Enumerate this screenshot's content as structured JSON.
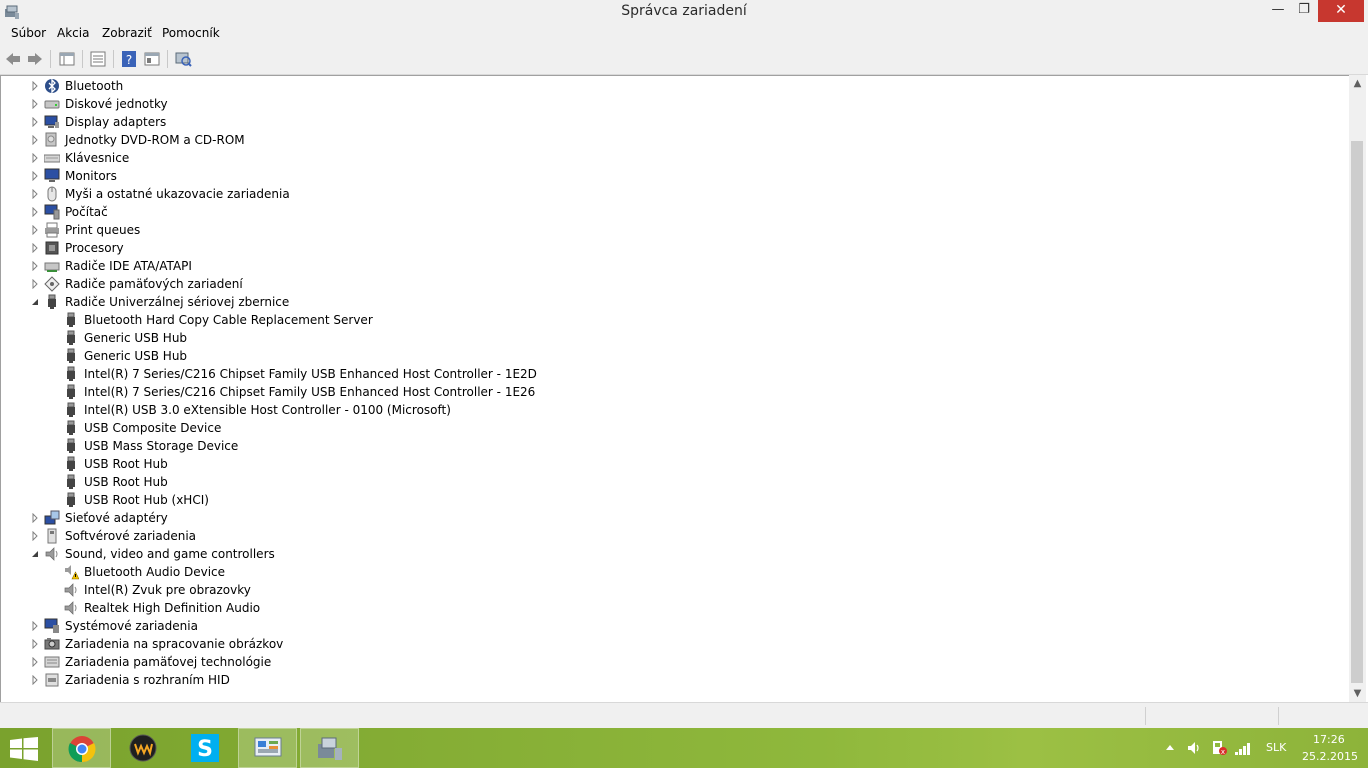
{
  "window": {
    "title": "Správca zariadení",
    "minimize_glyph": "—",
    "maximize_glyph": "❐",
    "close_glyph": "✕"
  },
  "menu": {
    "items": [
      {
        "label": "Súbor"
      },
      {
        "label": "Akcia"
      },
      {
        "label": "Zobraziť"
      },
      {
        "label": "Pomocník"
      }
    ]
  },
  "toolbar": {
    "buttons": [
      "back-icon",
      "forward-icon",
      "properties-view-icon",
      "details-icon",
      "help-icon",
      "console-tree-icon",
      "scan-hardware-icon"
    ]
  },
  "tree": {
    "items": [
      {
        "label": "Bluetooth",
        "icon": "bluetooth-icon",
        "expanded": false
      },
      {
        "label": "Diskové jednotky",
        "icon": "disk-drive-icon",
        "expanded": false
      },
      {
        "label": "Display adapters",
        "icon": "display-adapter-icon",
        "expanded": false
      },
      {
        "label": "Jednotky DVD-ROM a CD-ROM",
        "icon": "dvd-drive-icon",
        "expanded": false
      },
      {
        "label": "Klávesnice",
        "icon": "keyboard-icon",
        "expanded": false
      },
      {
        "label": "Monitors",
        "icon": "monitor-icon",
        "expanded": false
      },
      {
        "label": "Myši a ostatné ukazovacie zariadenia",
        "icon": "mouse-icon",
        "expanded": false
      },
      {
        "label": "Počítač",
        "icon": "computer-icon",
        "expanded": false
      },
      {
        "label": "Print queues",
        "icon": "printer-icon",
        "expanded": false
      },
      {
        "label": "Procesory",
        "icon": "processor-icon",
        "expanded": false
      },
      {
        "label": "Radiče IDE ATA/ATAPI",
        "icon": "ide-controller-icon",
        "expanded": false
      },
      {
        "label": "Radiče pamäťových zariadení",
        "icon": "storage-controller-icon",
        "expanded": false
      },
      {
        "label": "Radiče Univerzálnej sériovej zbernice",
        "icon": "usb-icon",
        "expanded": true,
        "children": [
          {
            "label": "Bluetooth Hard Copy Cable Replacement Server",
            "icon": "usb-icon"
          },
          {
            "label": "Generic USB Hub",
            "icon": "usb-icon"
          },
          {
            "label": "Generic USB Hub",
            "icon": "usb-icon"
          },
          {
            "label": "Intel(R) 7 Series/C216 Chipset Family USB Enhanced Host Controller - 1E2D",
            "icon": "usb-icon"
          },
          {
            "label": "Intel(R) 7 Series/C216 Chipset Family USB Enhanced Host Controller - 1E26",
            "icon": "usb-icon"
          },
          {
            "label": "Intel(R) USB 3.0 eXtensible Host Controller - 0100 (Microsoft)",
            "icon": "usb-icon"
          },
          {
            "label": "USB Composite Device",
            "icon": "usb-icon"
          },
          {
            "label": "USB Mass Storage Device",
            "icon": "usb-icon"
          },
          {
            "label": "USB Root Hub",
            "icon": "usb-icon"
          },
          {
            "label": "USB Root Hub",
            "icon": "usb-icon"
          },
          {
            "label": "USB Root Hub (xHCI)",
            "icon": "usb-icon"
          }
        ]
      },
      {
        "label": "Sieťové adaptéry",
        "icon": "network-adapter-icon",
        "expanded": false
      },
      {
        "label": "Softvérové zariadenia",
        "icon": "software-device-icon",
        "expanded": false
      },
      {
        "label": "Sound, video and game controllers",
        "icon": "speaker-icon",
        "expanded": true,
        "children": [
          {
            "label": "Bluetooth Audio Device",
            "icon": "speaker-warning-icon"
          },
          {
            "label": "Intel(R) Zvuk pre obrazovky",
            "icon": "speaker-icon"
          },
          {
            "label": "Realtek High Definition Audio",
            "icon": "speaker-icon"
          }
        ]
      },
      {
        "label": "Systémové zariadenia",
        "icon": "system-device-icon",
        "expanded": false
      },
      {
        "label": "Zariadenia na spracovanie obrázkov",
        "icon": "imaging-device-icon",
        "expanded": false
      },
      {
        "label": "Zariadenia pamäťovej technológie",
        "icon": "memory-technology-icon",
        "expanded": false
      },
      {
        "label": "Zariadenia s rozhraním HID",
        "icon": "hid-icon",
        "expanded": false
      }
    ]
  },
  "taskbar": {
    "apps": [
      {
        "name": "chrome-icon",
        "active": true
      },
      {
        "name": "winamp-icon",
        "active": false
      },
      {
        "name": "skype-icon",
        "active": false
      },
      {
        "name": "control-panel-icon",
        "active": true
      },
      {
        "name": "device-manager-icon",
        "active": true
      }
    ],
    "tray": {
      "language": "SLK",
      "time": "17:26",
      "date": "25.2.2015"
    },
    "colors": {
      "accent": "#8fb83c"
    }
  }
}
